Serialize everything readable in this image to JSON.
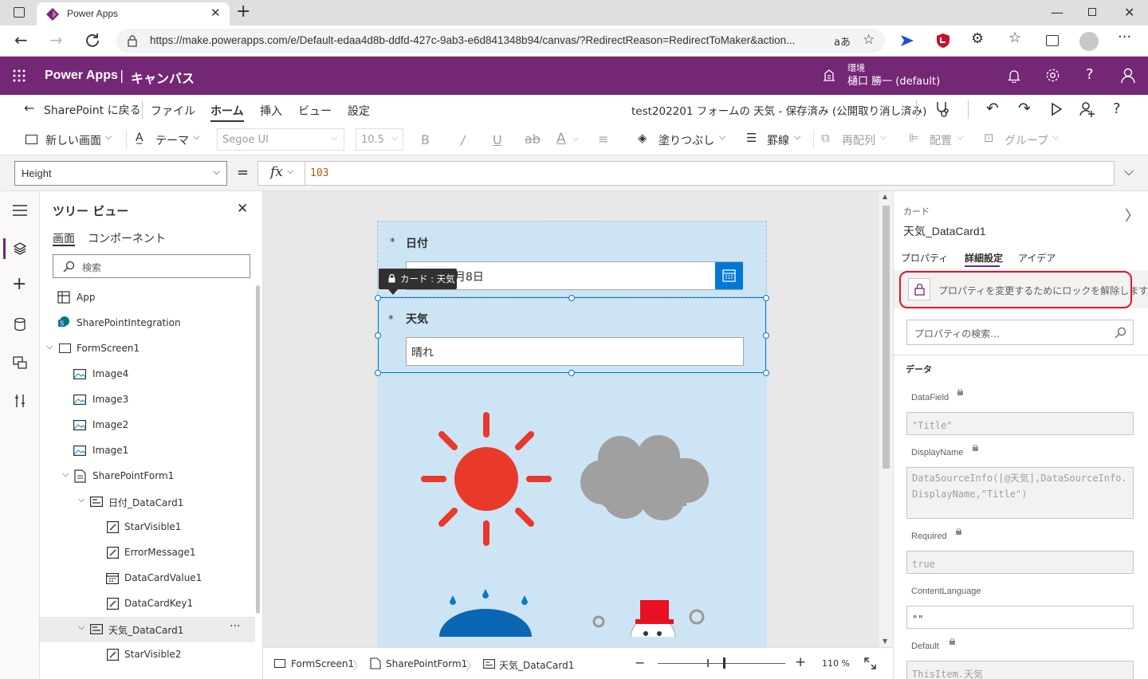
{
  "browser": {
    "tab_title": "Power Apps",
    "url": "https://make.powerapps.com/e/Default-edaa4d8b-ddfd-427c-9ab3-e6d841348b94/canvas/?RedirectReason=RedirectToMaker&action..."
  },
  "header": {
    "app_name": "Power Apps",
    "separator": "|",
    "section": "キャンバス",
    "env_label": "環境",
    "env_name": "樋口 勝一 (default)"
  },
  "commandbar": {
    "back": "SharePoint に戻る",
    "menus": [
      "ファイル",
      "ホーム",
      "挿入",
      "ビュー",
      "設定"
    ],
    "active_menu": "ホーム",
    "doc_status": "test202201 フォームの 天気 - 保存済み (公開取り消し済み)"
  },
  "ribbon": {
    "new_screen": "新しい画面",
    "theme": "テーマ",
    "font": "Segoe UI",
    "font_size": "10.5",
    "fill": "塗りつぶし",
    "border": "罫線",
    "reorder": "再配列",
    "align": "配置",
    "group": "グループ"
  },
  "formula": {
    "property": "Height",
    "equals": "=",
    "fx": "fx",
    "value": "103"
  },
  "tree": {
    "title": "ツリー ビュー",
    "tabs": [
      "画面",
      "コンポーネント"
    ],
    "search_placeholder": "検索",
    "items": [
      {
        "label": "App"
      },
      {
        "label": "SharePointIntegration"
      },
      {
        "label": "FormScreen1"
      },
      {
        "label": "Image4"
      },
      {
        "label": "Image3"
      },
      {
        "label": "Image2"
      },
      {
        "label": "Image1"
      },
      {
        "label": "SharePointForm1"
      },
      {
        "label": "日付_DataCard1"
      },
      {
        "label": "StarVisible1"
      },
      {
        "label": "ErrorMessage1"
      },
      {
        "label": "DataCardValue1"
      },
      {
        "label": "DataCardKey1"
      },
      {
        "label": "天気_DataCard1"
      },
      {
        "label": "StarVisible2"
      }
    ],
    "more": "···"
  },
  "form": {
    "date_star": "*",
    "date_label": "日付",
    "date_value": "月8日",
    "tooltip": "カード : 天気",
    "weather_star": "*",
    "weather_label": "天気",
    "weather_value": "晴れ"
  },
  "statusbar": {
    "crumbs": [
      "FormScreen1",
      "SharePointForm1",
      "天気_DataCard1"
    ],
    "zoom_minus": "−",
    "zoom_plus": "+",
    "zoom": "110 %"
  },
  "properties": {
    "type_label": "カード",
    "name": "天気_DataCard1",
    "tabs": [
      "プロパティ",
      "詳細設定",
      "アイデア"
    ],
    "active_tab": "詳細設定",
    "unlock_message": "プロパティを変更するためにロックを解除します。",
    "search_placeholder": "プロパティの検索...",
    "section": "データ",
    "fields": [
      {
        "label": "DataField",
        "value": "\"Title\""
      },
      {
        "label": "DisplayName",
        "value": "DataSourceInfo([@天気],DataSourceInfo.DisplayName,\"Title\")"
      },
      {
        "label": "Required",
        "value": "true"
      },
      {
        "label": "ContentLanguage",
        "value": "\"\""
      },
      {
        "label": "Default",
        "value": "ThisItem.天気"
      }
    ]
  },
  "colors": {
    "brand": "#742774",
    "accent": "#0078d4",
    "highlight": "#e81123",
    "form_bg": "#cde4f4",
    "sun": "#e8392b",
    "cloud": "#a0a0a0"
  }
}
